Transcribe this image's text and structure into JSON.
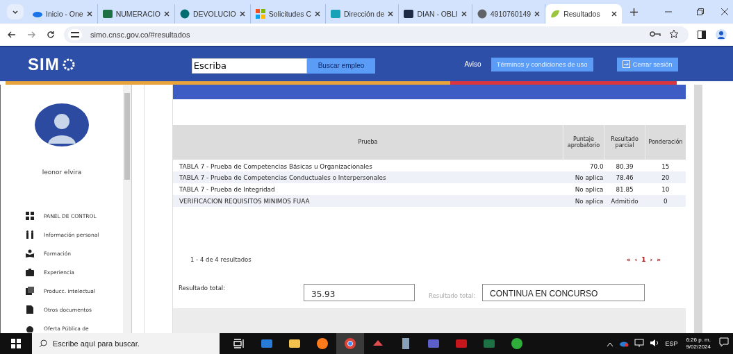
{
  "browser": {
    "tabs": [
      {
        "title": "Inicio - One",
        "kind": "cloud",
        "selected": false
      },
      {
        "title": "NUMERACIO",
        "kind": "excel",
        "selected": false
      },
      {
        "title": "DEVOLUCIO",
        "kind": "sharepoint",
        "selected": false
      },
      {
        "title": "Solicitudes C",
        "kind": "windows",
        "selected": false
      },
      {
        "title": "Dirección de",
        "kind": "frame",
        "selected": false
      },
      {
        "title": "DIAN - OBLI",
        "kind": "dark-frame",
        "selected": false
      },
      {
        "title": "4910760149",
        "kind": "globe",
        "selected": false
      },
      {
        "title": "Resultados",
        "kind": "leaf",
        "selected": true
      }
    ],
    "url": "simo.cnsc.gov.co/#resultados"
  },
  "header": {
    "logo": "SIM",
    "search": {
      "value": "Escriba"
    },
    "search_button": "Buscar empleo",
    "notice_link": "Aviso",
    "terms_button": "Términos y condiciones de uso",
    "logout_button": "Cerrar sesión"
  },
  "sidebar": {
    "user_name": "leonor elvira",
    "items": [
      {
        "label": "PANEL DE CONTROL",
        "kind": "dashboard"
      },
      {
        "label": "Información personal",
        "kind": "people"
      },
      {
        "label": "Formación",
        "kind": "reader"
      },
      {
        "label": "Experiencia",
        "kind": "briefcase"
      },
      {
        "label": "Producc. intelectual",
        "kind": "documents"
      },
      {
        "label": "Otros documentos",
        "kind": "document"
      },
      {
        "label": "Oferta Pública de",
        "kind": "circle"
      }
    ]
  },
  "table": {
    "columns": [
      "Prueba",
      "Puntaje aprobatorio",
      "Resultado parcial",
      "Ponderación"
    ],
    "rows": [
      [
        "TABLA 7 - Prueba de Competencias Básicas u Organizacionales",
        "70.0",
        "80.39",
        "15"
      ],
      [
        "TABLA 7 - Prueba de Competencias Conductuales o Interpersonales",
        "No aplica",
        "78.46",
        "20"
      ],
      [
        "TABLA 7 - Prueba de Integridad",
        "No aplica",
        "81.85",
        "10"
      ],
      [
        "VERIFICACION REQUISITOS MINIMOS FUAA",
        "No aplica",
        "Admitido",
        "0"
      ]
    ]
  },
  "pagination": {
    "summary": "1 - 4 de 4 resultados",
    "controls": [
      "«",
      "‹",
      "1",
      "›",
      "»"
    ]
  },
  "results": [
    {
      "label": "Resultado total:",
      "value": "35.93",
      "faded": false
    },
    {
      "label": "Resultado total:",
      "value": "CONTINUA EN CONCURSO",
      "faded": true
    }
  ],
  "taskbar": {
    "search_placeholder": "Escribe aquí para buscar.",
    "apps": [
      {
        "kind": "task-view",
        "selected": false
      },
      {
        "kind": "mail",
        "selected": false
      },
      {
        "kind": "folder",
        "selected": false
      },
      {
        "kind": "firefox",
        "selected": false
      },
      {
        "kind": "chrome",
        "selected": true
      },
      {
        "kind": "satellite",
        "selected": false
      },
      {
        "kind": "calculator",
        "selected": false
      },
      {
        "kind": "teams",
        "selected": false
      },
      {
        "kind": "pdf",
        "selected": false
      },
      {
        "kind": "excel",
        "selected": false
      },
      {
        "kind": "money",
        "selected": false
      }
    ],
    "language": "ESP",
    "time": "6:26 p. m.",
    "date": "9/02/2024"
  }
}
